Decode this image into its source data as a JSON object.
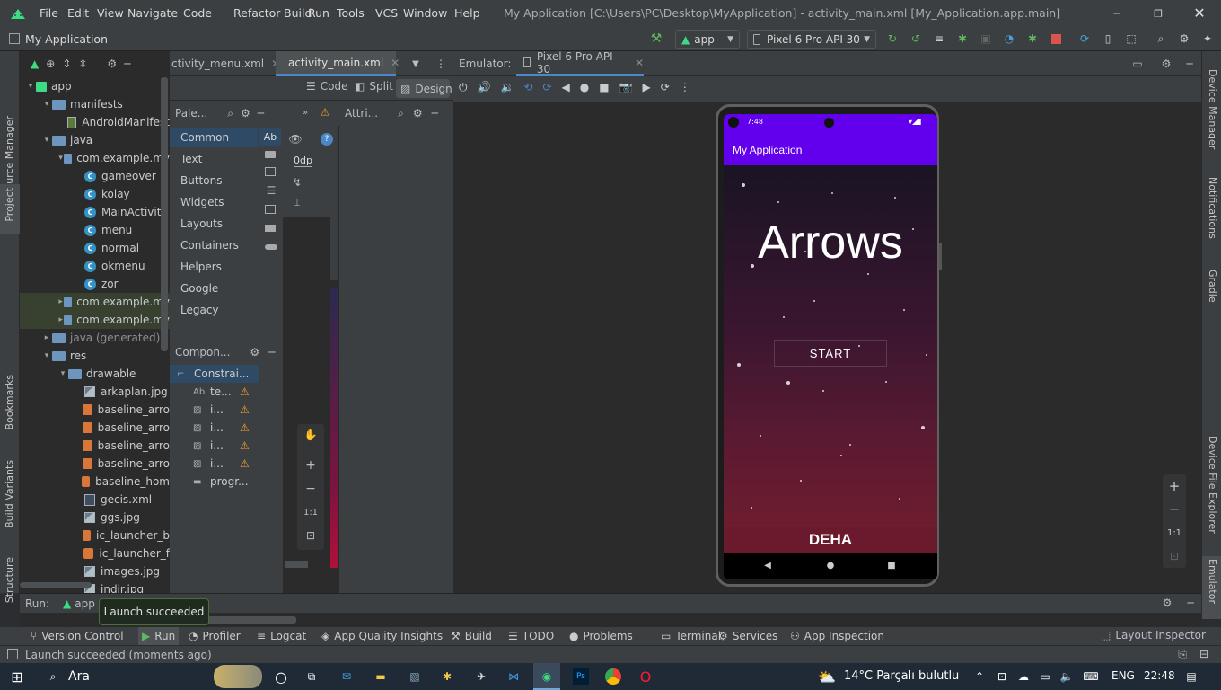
{
  "titlebar": {
    "menus": [
      "File",
      "Edit",
      "View",
      "Navigate",
      "Code",
      "Refactor",
      "Build",
      "Run",
      "Tools",
      "VCS",
      "Window",
      "Help"
    ],
    "title": "My Application [C:\\Users\\PC\\Desktop\\MyApplication] - activity_main.xml [My_Application.app.main]"
  },
  "toolbar": {
    "project": "My Application",
    "run_config": "app",
    "device": "Pixel 6 Pro API 30"
  },
  "side": {
    "left_top": [
      "Resource Manager",
      "Project"
    ],
    "left_bottom": [
      "Bookmarks",
      "Build Variants",
      "Structure"
    ],
    "right": [
      "Device Manager",
      "Notifications",
      "Gradle",
      "Device File Explorer",
      "Emulator"
    ]
  },
  "project_tree": [
    {
      "label": "app",
      "indent": 0,
      "arrow": "▾",
      "icon": "module"
    },
    {
      "label": "manifests",
      "indent": 1,
      "arrow": "▾",
      "icon": "folder"
    },
    {
      "label": "AndroidManifest",
      "indent": 2,
      "arrow": "",
      "icon": "manifest"
    },
    {
      "label": "java",
      "indent": 1,
      "arrow": "▾",
      "icon": "folder"
    },
    {
      "label": "com.example.my",
      "indent": 2,
      "arrow": "▾",
      "icon": "package"
    },
    {
      "label": "gameover",
      "indent": 3,
      "arrow": "",
      "icon": "class"
    },
    {
      "label": "kolay",
      "indent": 3,
      "arrow": "",
      "icon": "class"
    },
    {
      "label": "MainActivity",
      "indent": 3,
      "arrow": "",
      "icon": "class"
    },
    {
      "label": "menu",
      "indent": 3,
      "arrow": "",
      "icon": "class"
    },
    {
      "label": "normal",
      "indent": 3,
      "arrow": "",
      "icon": "class"
    },
    {
      "label": "okmenu",
      "indent": 3,
      "arrow": "",
      "icon": "class"
    },
    {
      "label": "zor",
      "indent": 3,
      "arrow": "",
      "icon": "class"
    },
    {
      "label": "com.example.my",
      "indent": 2,
      "arrow": "▸",
      "icon": "package",
      "sel": true
    },
    {
      "label": "com.example.my",
      "indent": 2,
      "arrow": "▸",
      "icon": "package",
      "sel": true
    },
    {
      "label": "java (generated)",
      "indent": 1,
      "arrow": "▸",
      "icon": "folder",
      "dim": true
    },
    {
      "label": "res",
      "indent": 1,
      "arrow": "▾",
      "icon": "folder"
    },
    {
      "label": "drawable",
      "indent": 2,
      "arrow": "▾",
      "icon": "folder"
    },
    {
      "label": "arkaplan.jpg",
      "indent": 3,
      "arrow": "",
      "icon": "image"
    },
    {
      "label": "baseline_arro",
      "indent": 3,
      "arrow": "",
      "icon": "vector"
    },
    {
      "label": "baseline_arro",
      "indent": 3,
      "arrow": "",
      "icon": "vector"
    },
    {
      "label": "baseline_arro",
      "indent": 3,
      "arrow": "",
      "icon": "vector"
    },
    {
      "label": "baseline_arro",
      "indent": 3,
      "arrow": "",
      "icon": "vector"
    },
    {
      "label": "baseline_hom",
      "indent": 3,
      "arrow": "",
      "icon": "vector"
    },
    {
      "label": "gecis.xml",
      "indent": 3,
      "arrow": "",
      "icon": "xml"
    },
    {
      "label": "ggs.jpg",
      "indent": 3,
      "arrow": "",
      "icon": "image"
    },
    {
      "label": "ic_launcher_b",
      "indent": 3,
      "arrow": "",
      "icon": "vector"
    },
    {
      "label": "ic_launcher_f",
      "indent": 3,
      "arrow": "",
      "icon": "vector"
    },
    {
      "label": "images.jpg",
      "indent": 3,
      "arrow": "",
      "icon": "image"
    },
    {
      "label": "indir.jpg",
      "indent": 3,
      "arrow": "",
      "icon": "image"
    }
  ],
  "editor": {
    "tabs": [
      "ctivity_menu.xml",
      "activity_main.xml"
    ],
    "modes": [
      "Code",
      "Split",
      "Design"
    ]
  },
  "palette": {
    "title": "Pale...",
    "categories": [
      "Common",
      "Text",
      "Buttons",
      "Widgets",
      "Layouts",
      "Containers",
      "Helpers",
      "Google",
      "Legacy"
    ],
    "attr_title": "Attri...",
    "dp": "0dp",
    "ab": "Ab"
  },
  "component_tree": {
    "title": "Compon...",
    "items": [
      {
        "label": "Constrai...",
        "icon": "layout",
        "warn": false
      },
      {
        "label": "te...",
        "icon": "text",
        "warn": true
      },
      {
        "label": "i...",
        "icon": "image",
        "warn": true
      },
      {
        "label": "i...",
        "icon": "image",
        "warn": true
      },
      {
        "label": "i...",
        "icon": "image",
        "warn": true
      },
      {
        "label": "i...",
        "icon": "image",
        "warn": true
      },
      {
        "label": "progr...",
        "icon": "progress",
        "warn": false
      }
    ]
  },
  "canvas": {
    "zoom_fit": "1:1"
  },
  "emulator": {
    "label": "Emulator:",
    "tab": "Pixel 6 Pro API 30",
    "zoom": "1:1"
  },
  "phone": {
    "time": "7:48",
    "appbar": "My Application",
    "title": "Arrows",
    "button": "START",
    "footer": "DEHA"
  },
  "run": {
    "label": "Run:",
    "config": "app",
    "tooltip": "Launch succeeded"
  },
  "bottom_tabs": [
    "Version Control",
    "Run",
    "Profiler",
    "Logcat",
    "App Quality Insights",
    "Build",
    "TODO",
    "Problems",
    "Terminal",
    "Services",
    "App Inspection"
  ],
  "layout_inspector": "Layout Inspector",
  "status": {
    "message": "Launch succeeded (moments ago)"
  },
  "taskbar": {
    "search": "Ara",
    "weather": "14°C  Parçalı bulutlu",
    "lang": "ENG",
    "time": "22:48"
  }
}
